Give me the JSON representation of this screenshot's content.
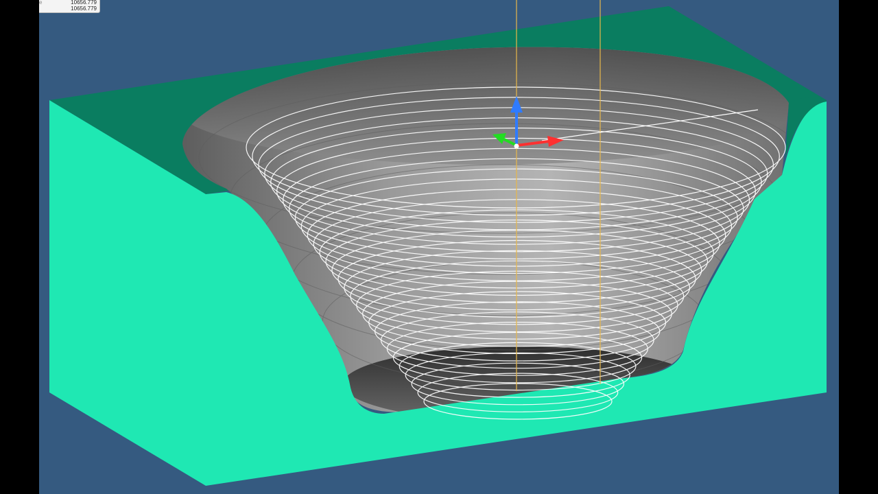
{
  "stats": {
    "rows": [
      {
        "label": "e",
        "value": "10656.779"
      },
      {
        "label": "",
        "value": "10656.779"
      }
    ]
  },
  "colors": {
    "background": "#355a80",
    "stock_front": "#1fe8b3",
    "stock_top": "#0a7d60",
    "stock_side": "#13b890",
    "surface": "#8a8a8a",
    "toolpath": "#ffffff",
    "axis_x": "#ff3030",
    "axis_y": "#22dd22",
    "axis_z": "#2f7bff",
    "guide_line": "#e8b84a"
  },
  "triad": {
    "x_icon": "x-axis-arrow-icon",
    "y_icon": "y-axis-arrow-icon",
    "z_icon": "z-axis-arrow-icon"
  }
}
